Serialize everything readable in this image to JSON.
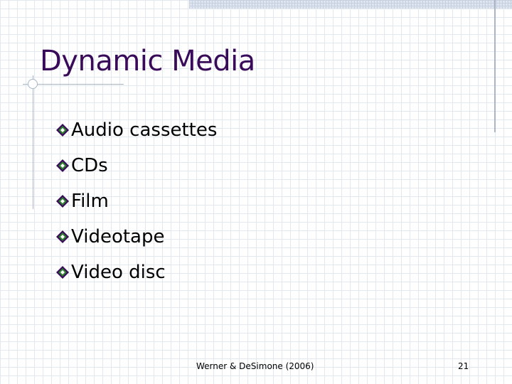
{
  "slide": {
    "title": "Dynamic Media",
    "bullet_icon": "diamond-bullet-icon",
    "bullets": [
      {
        "text": "Audio cassettes"
      },
      {
        "text": "CDs"
      },
      {
        "text": "Film"
      },
      {
        "text": "Videotape"
      },
      {
        "text": "Video disc"
      }
    ],
    "footer": {
      "source": "Werner & DeSimone (2006)",
      "page_number": "21"
    }
  },
  "colors": {
    "title": "#3a0a5a",
    "bullet_purple": "#3a0a5a",
    "bullet_green": "#2e7d2e",
    "grid": "#e3e8f0",
    "accent_line": "#aab6c8"
  }
}
